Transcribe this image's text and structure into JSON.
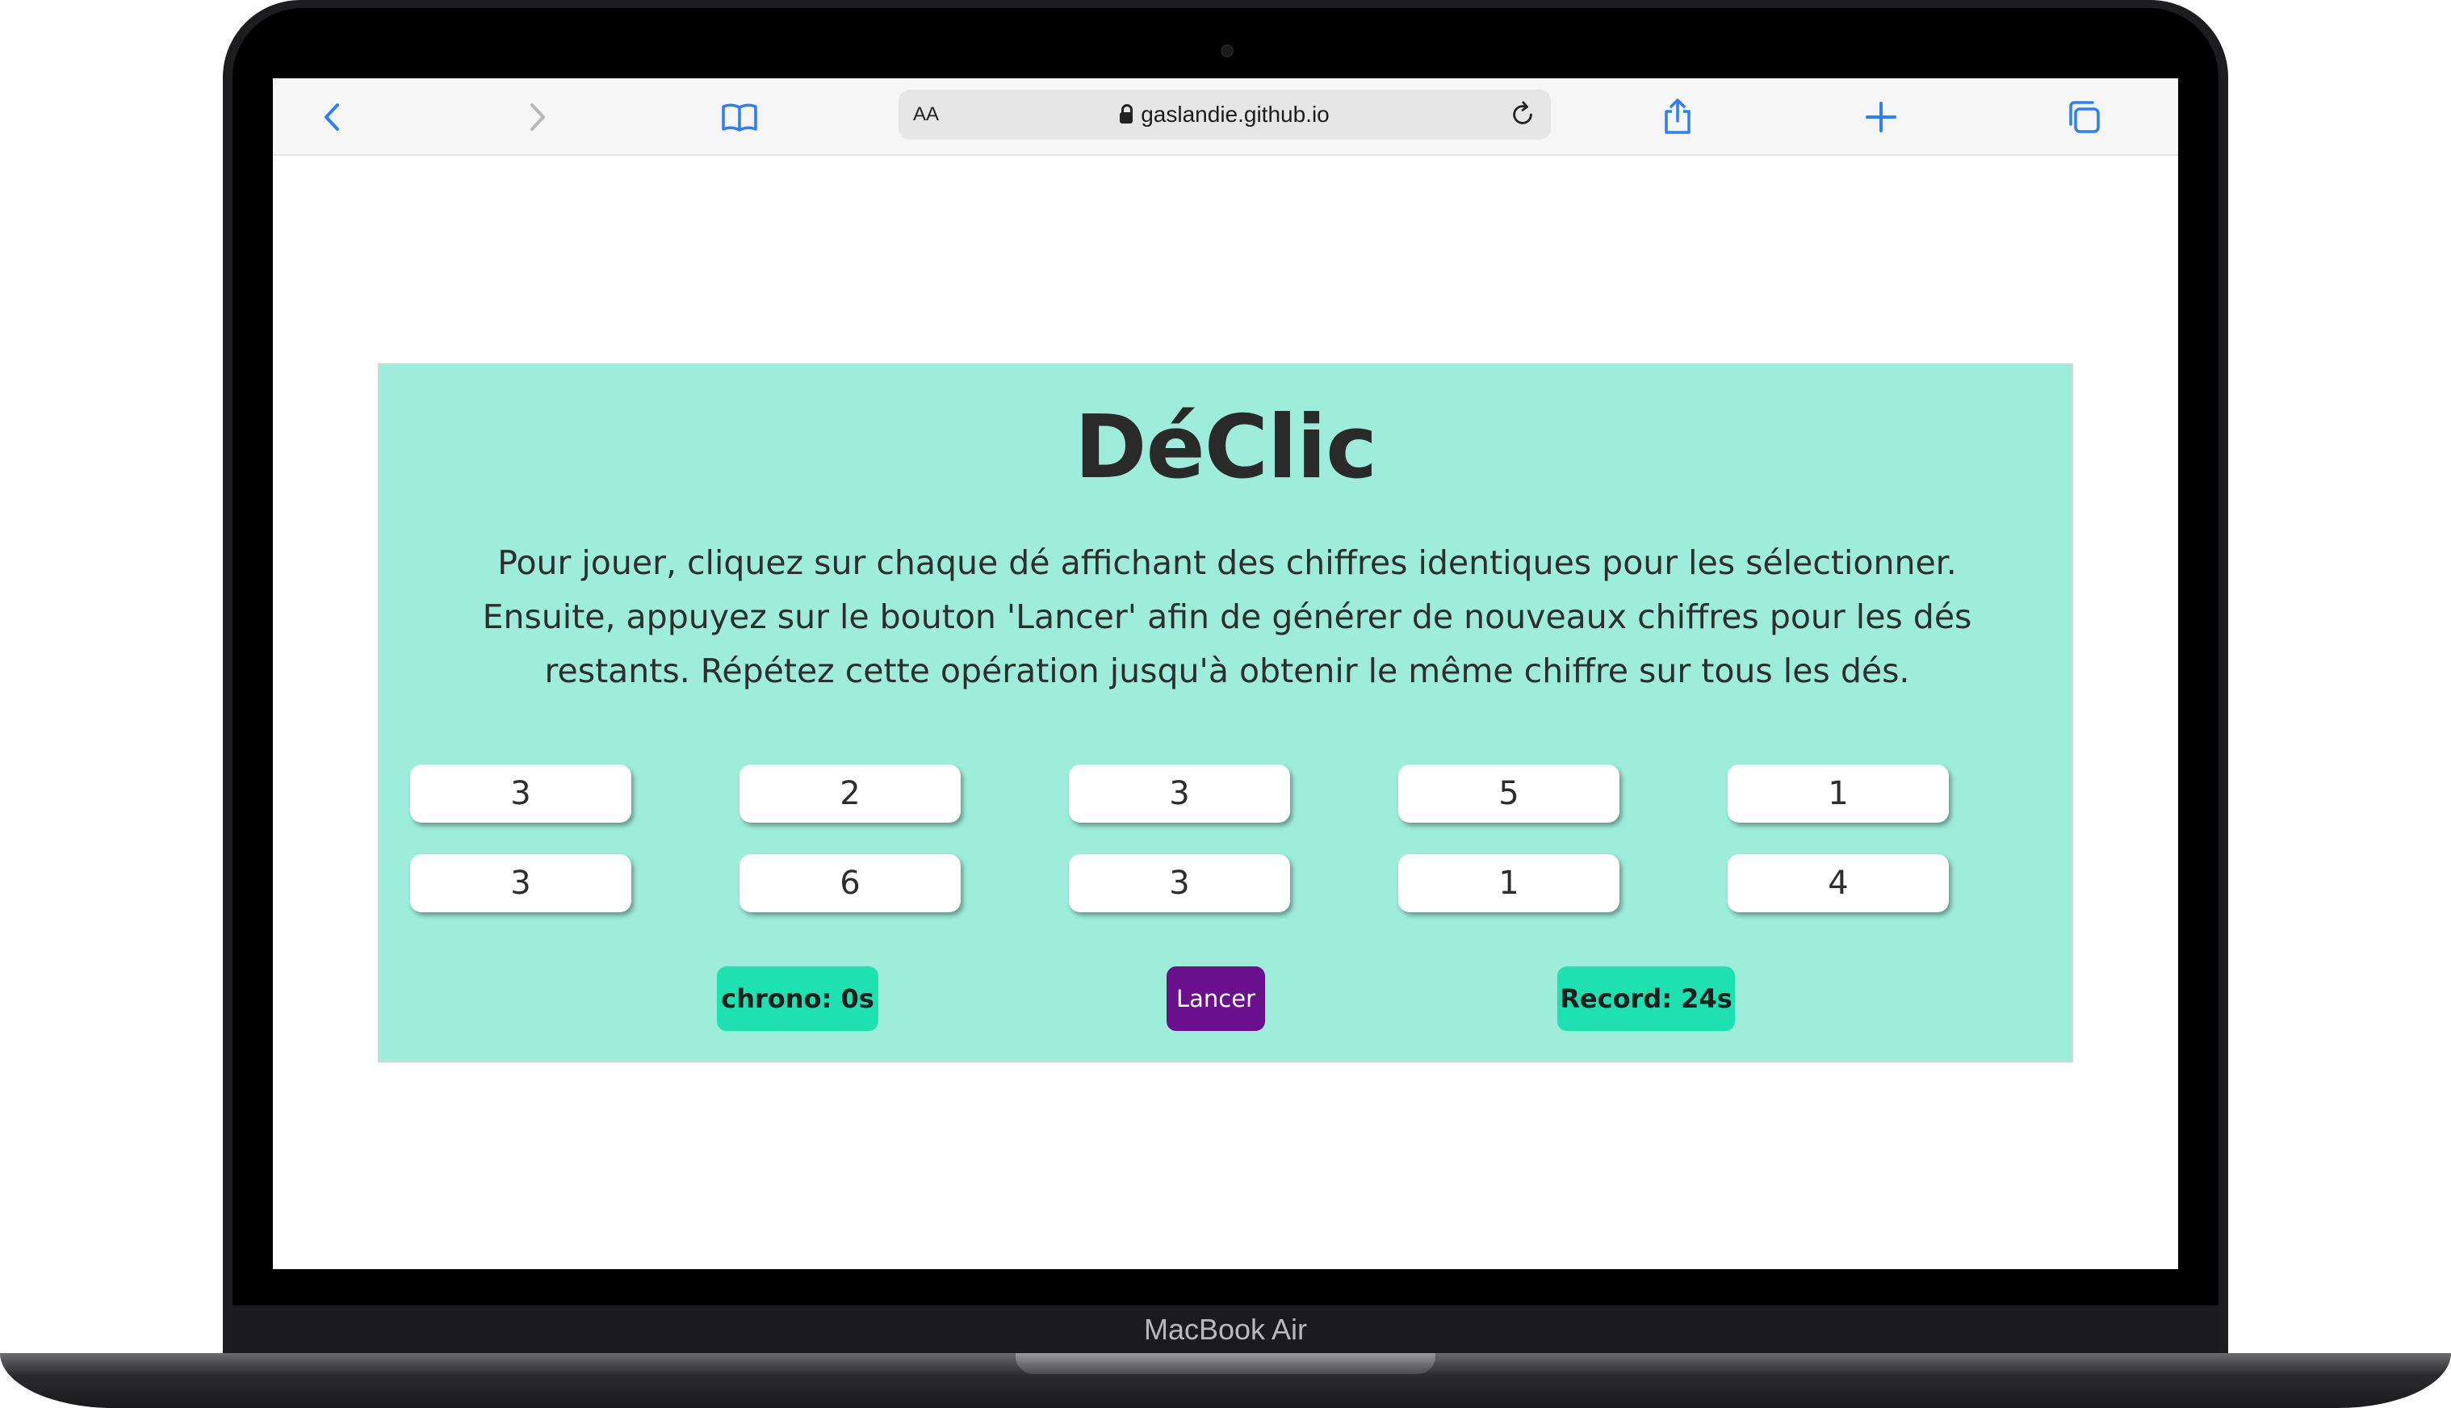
{
  "device": {
    "brand_label": "MacBook Air"
  },
  "browser": {
    "text_size_label": "AA",
    "url": "gaslandie.github.io",
    "icons": [
      "chevron-left-icon",
      "chevron-right-icon",
      "book-icon",
      "reload-icon",
      "share-icon",
      "plus-icon",
      "tabs-icon",
      "lock-icon"
    ]
  },
  "game": {
    "title": "DéClic",
    "instructions": "Pour jouer, cliquez sur chaque dé affichant des chiffres identiques pour les sélectionner. Ensuite, appuyez sur le bouton 'Lancer' afin de générer de nouveaux chiffres pour les dés restants. Répétez cette opération jusqu'à obtenir le même chiffre sur tous les dés.",
    "dice": [
      "3",
      "2",
      "3",
      "5",
      "1",
      "3",
      "6",
      "3",
      "1",
      "4"
    ],
    "chrono_label": "chrono: 0s",
    "roll_button_label": "Lancer",
    "record_label": "Record: 24s",
    "colors": {
      "panel_background": "#9eecda",
      "badge_background": "#1fe0b0",
      "roll_button_background": "#6a0f8e"
    }
  }
}
